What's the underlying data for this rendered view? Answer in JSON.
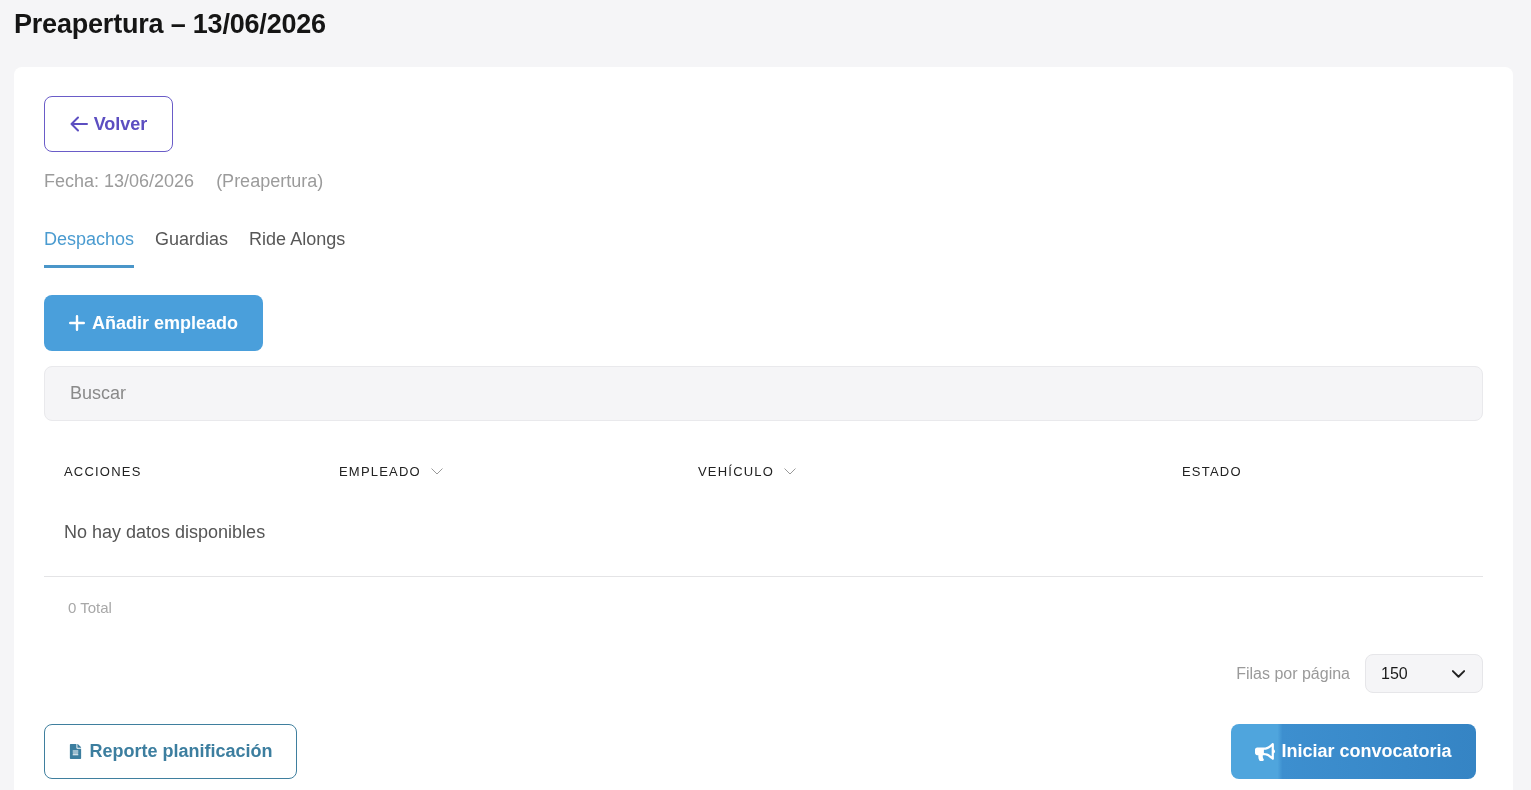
{
  "page": {
    "title": "Preapertura – 13/06/2026"
  },
  "back_button": {
    "label": "Volver"
  },
  "info": {
    "date": "Fecha: 13/06/2026",
    "type": "(Preapertura)"
  },
  "tabs": [
    {
      "label": "Despachos",
      "selected": true
    },
    {
      "label": "Guardias",
      "selected": false
    },
    {
      "label": "Ride Alongs",
      "selected": false
    }
  ],
  "add_button": {
    "label": "Añadir empleado"
  },
  "search": {
    "placeholder": "Buscar"
  },
  "table": {
    "columns": [
      {
        "label": "ACCIONES",
        "sortable": false
      },
      {
        "label": "EMPLEADO",
        "sortable": true
      },
      {
        "label": "VEHÍCULO",
        "sortable": true
      },
      {
        "label": "ESTADO",
        "sortable": false
      }
    ],
    "empty_message": "No hay datos disponibles"
  },
  "total": "0 Total",
  "pagination": {
    "label": "Filas por página",
    "rows_per_page": "150"
  },
  "buttons": [
    {
      "kind": "outline",
      "label": "Reporte planificación"
    },
    {
      "kind": "primary",
      "label": "Iniciar convocatoria"
    }
  ]
}
